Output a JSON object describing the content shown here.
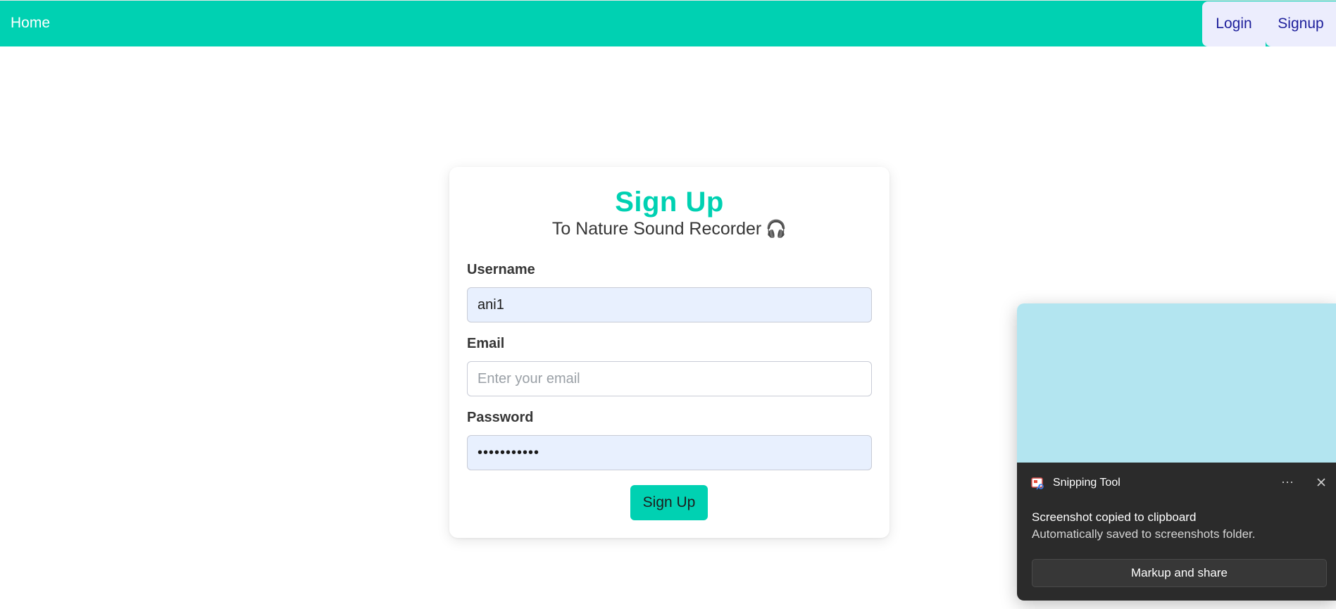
{
  "navbar": {
    "home_label": "Home",
    "login_label": "Login",
    "signup_label": "Signup",
    "bg_color": "#00d1b2"
  },
  "card": {
    "title": "Sign Up",
    "subtitle": "To Nature Sound Recorder",
    "subtitle_icon": "🎧",
    "fields": [
      {
        "label": "Username",
        "value": "ani1",
        "placeholder": ""
      },
      {
        "label": "Email",
        "value": "",
        "placeholder": "Enter your email"
      },
      {
        "label": "Password",
        "value": "•••••••••••",
        "placeholder": ""
      }
    ],
    "submit_label": "Sign Up",
    "accent_color": "#00d1b2"
  },
  "toast": {
    "app_name": "Snipping Tool",
    "more_label": "···",
    "title": "Screenshot copied to clipboard",
    "text": "Automatically saved to screenshots folder.",
    "action_label": "Markup and share"
  }
}
